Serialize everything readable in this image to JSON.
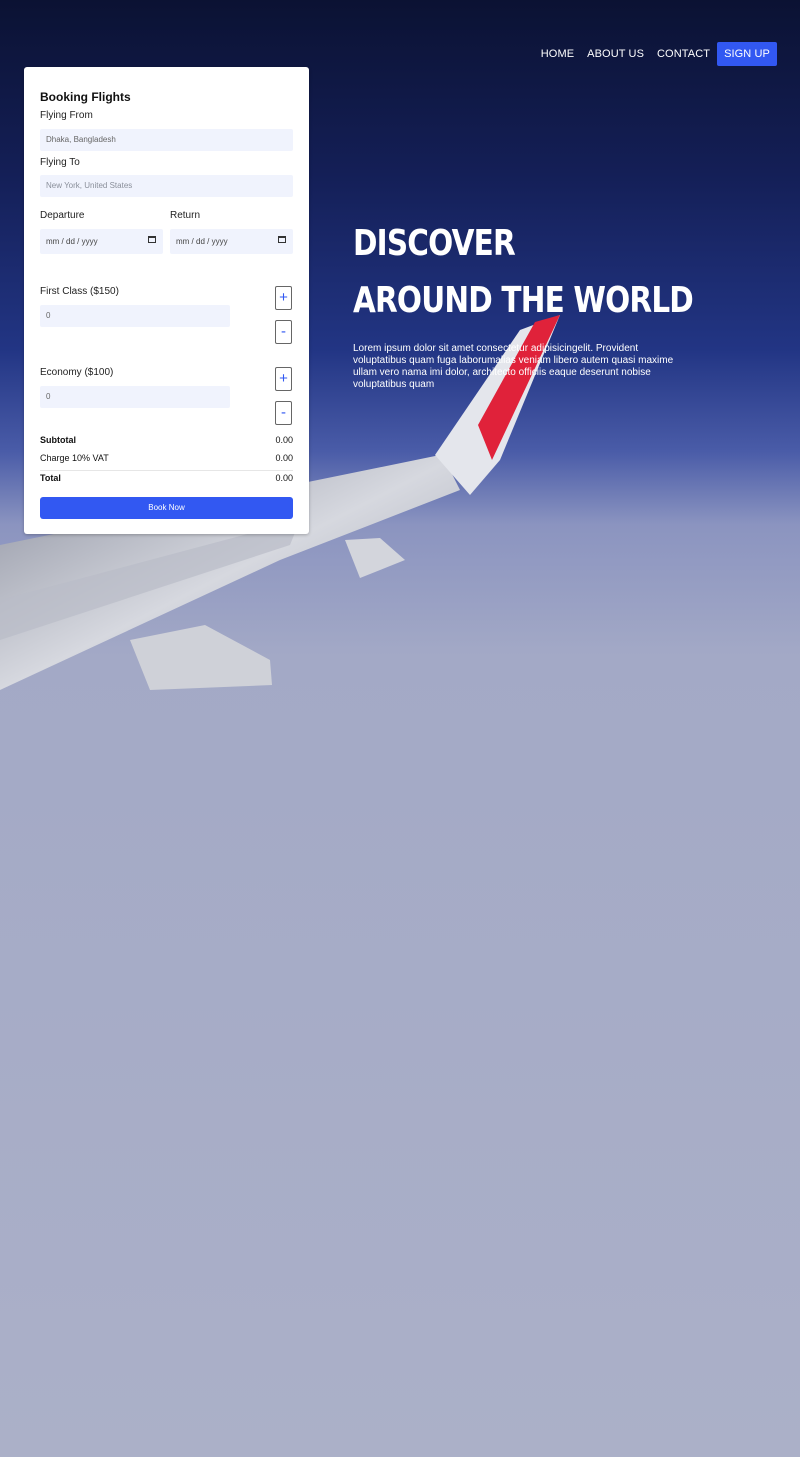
{
  "nav": {
    "home": "HOME",
    "about": "ABOUT US",
    "contact": "CONTACT",
    "signup": "SIGN UP"
  },
  "booking": {
    "title": "Booking Flights",
    "flying_from_label": "Flying From",
    "flying_from_value": "Dhaka, Bangladesh",
    "flying_to_label": "Flying To",
    "flying_to_placeholder": "New York, United States",
    "departure_label": "Departure",
    "return_label": "Return",
    "date_placeholder": "mm / dd / yyyy",
    "first_class_label": "First Class ($150)",
    "first_class_value": "0",
    "economy_label": "Economy ($100)",
    "economy_value": "0",
    "plus": "+",
    "minus": "-",
    "subtotal_label": "Subtotal",
    "subtotal_value": "0.00",
    "vat_label": "Charge 10% VAT",
    "vat_value": "0.00",
    "total_label": "Total",
    "total_value": "0.00",
    "book_button": "Book Now"
  },
  "hero": {
    "line1": "DISCOVER",
    "line2": "AROUND THE WORLD",
    "description": "Lorem ipsum dolor sit amet consectetur adipisicingelit. Provident voluptatibus quam fuga laborumalias veniam libero autem quasi maxime ullam vero nama imi dolor, architecto officiis eaque deserunt nobise voluptatibus quam"
  },
  "colors": {
    "accent": "#3258f2",
    "sky_top": "#0c1335",
    "cloud": "#aab0c7"
  }
}
